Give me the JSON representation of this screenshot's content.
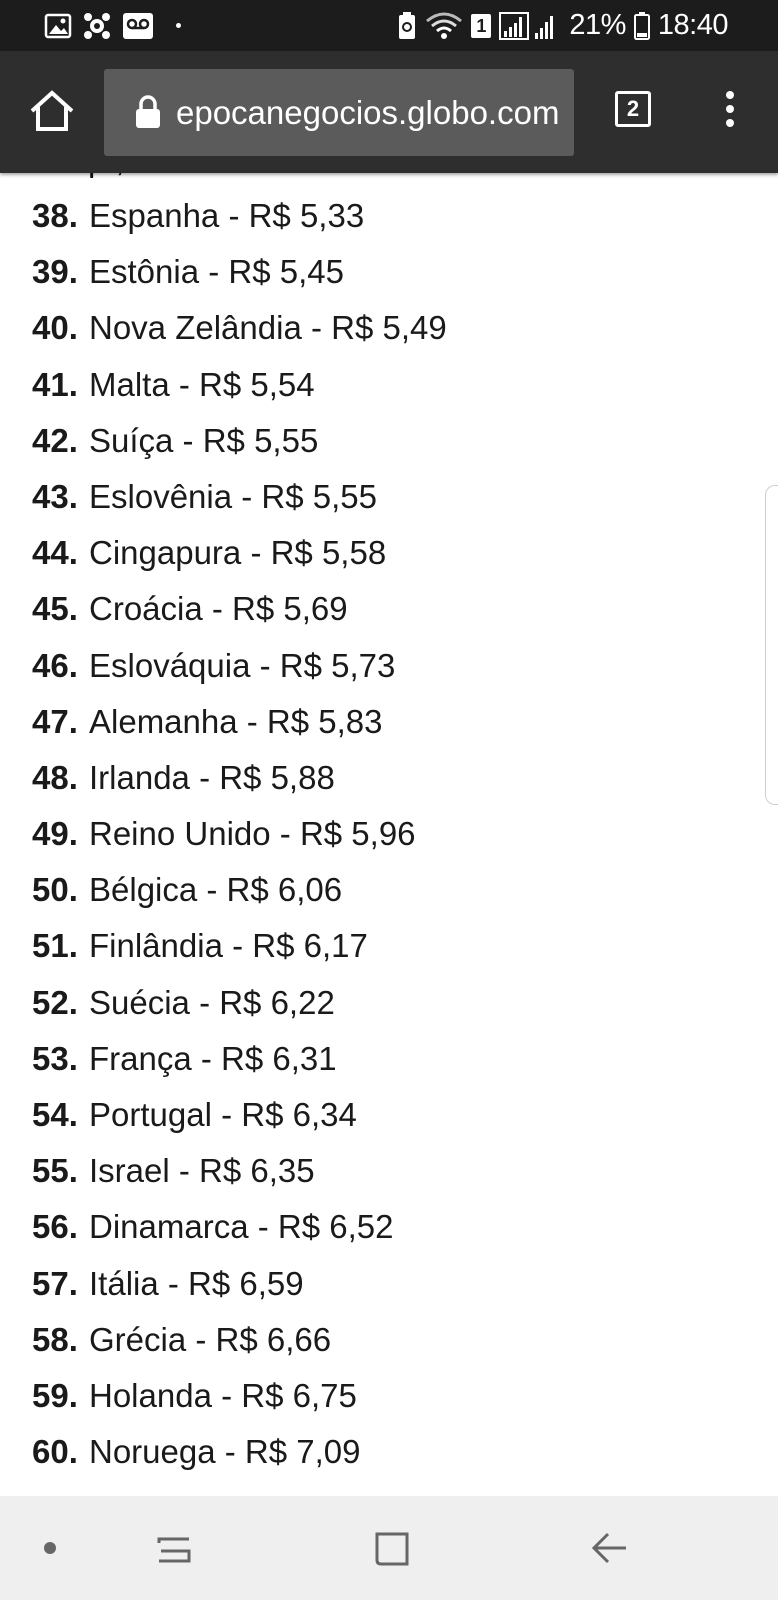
{
  "status_bar": {
    "icons_left": [
      "image-icon",
      "app-icon",
      "voicemail-icon",
      "dot-icon"
    ],
    "icons_right": [
      "battery-saver-icon",
      "wifi-icon",
      "signal-icon"
    ],
    "sim_badge": "1",
    "battery": "21%",
    "time": "18:40"
  },
  "browser": {
    "url": "epocanegocios.globo.com",
    "tab_count": "2"
  },
  "content": {
    "partial_line": "p       ,",
    "items": [
      {
        "num": "38.",
        "text": "Espanha - R$ 5,33"
      },
      {
        "num": "39.",
        "text": "Estônia - R$ 5,45"
      },
      {
        "num": "40.",
        "text": "Nova Zelândia - R$ 5,49"
      },
      {
        "num": "41.",
        "text": "Malta - R$ 5,54"
      },
      {
        "num": "42.",
        "text": "Suíça - R$ 5,55"
      },
      {
        "num": "43.",
        "text": "Eslovênia - R$ 5,55"
      },
      {
        "num": "44.",
        "text": "Cingapura - R$ 5,58"
      },
      {
        "num": "45.",
        "text": "Croácia - R$ 5,69"
      },
      {
        "num": "46.",
        "text": "Eslováquia - R$ 5,73"
      },
      {
        "num": "47.",
        "text": "Alemanha - R$ 5,83"
      },
      {
        "num": "48.",
        "text": "Irlanda - R$ 5,88"
      },
      {
        "num": "49.",
        "text": "Reino Unido - R$ 5,96"
      },
      {
        "num": "50.",
        "text": "Bélgica - R$ 6,06"
      },
      {
        "num": "51.",
        "text": "Finlândia - R$ 6,17"
      },
      {
        "num": "52.",
        "text": "Suécia - R$ 6,22"
      },
      {
        "num": "53.",
        "text": "França - R$ 6,31"
      },
      {
        "num": "54.",
        "text": "Portugal - R$ 6,34"
      },
      {
        "num": "55.",
        "text": "Israel - R$ 6,35"
      },
      {
        "num": "56.",
        "text": "Dinamarca - R$ 6,52"
      },
      {
        "num": "57.",
        "text": "Itália - R$ 6,59"
      },
      {
        "num": "58.",
        "text": "Grécia - R$ 6,66"
      },
      {
        "num": "59.",
        "text": "Holanda - R$ 6,75"
      },
      {
        "num": "60.",
        "text": "Noruega - R$ 7,09"
      }
    ]
  },
  "navbar": {
    "buttons": [
      "dot-icon",
      "recent-apps-icon",
      "home-icon",
      "back-icon"
    ]
  },
  "colors": {
    "status_bar_bg": "#1c1c1c",
    "toolbar_bg": "#2e2e2e",
    "urlbar_bg": "#5b5b5b",
    "navbar_bg": "#efefef",
    "text": "#1a1a1a"
  }
}
